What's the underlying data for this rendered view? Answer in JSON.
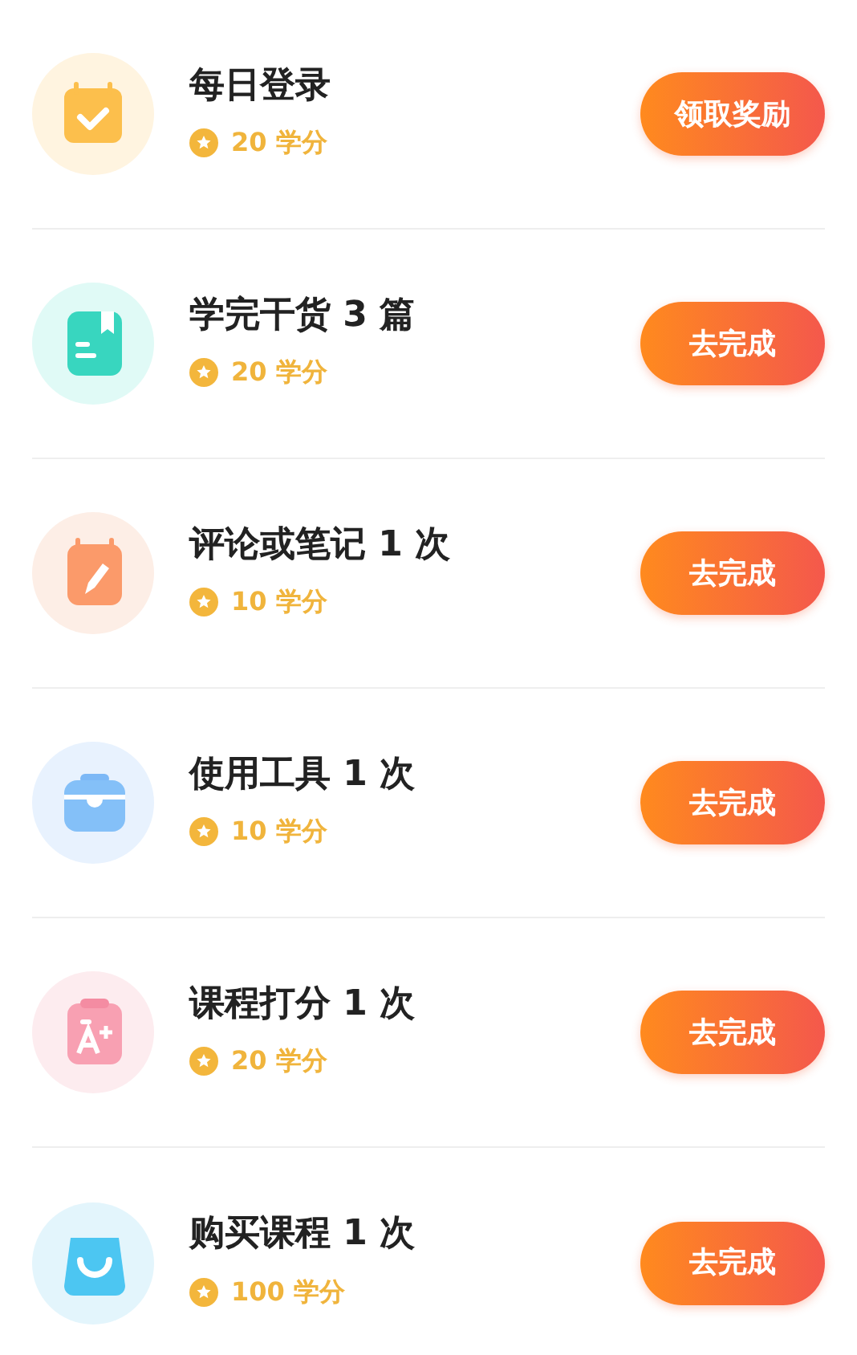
{
  "tasks": [
    {
      "kind": "calendar-check",
      "title": "每日登录",
      "points": "20 学分",
      "action": "领取奖励"
    },
    {
      "kind": "book",
      "title": "学完干货 3 篇",
      "points": "20 学分",
      "action": "去完成"
    },
    {
      "kind": "calendar-pencil",
      "title": "评论或笔记 1 次",
      "points": "10 学分",
      "action": "去完成"
    },
    {
      "kind": "toolbox",
      "title": "使用工具 1 次",
      "points": "10 学分",
      "action": "去完成"
    },
    {
      "kind": "clipboard",
      "title": "课程打分 1 次",
      "points": "20 学分",
      "action": "去完成"
    },
    {
      "kind": "bag",
      "title": "购买课程 1 次",
      "points": "100 学分",
      "action": "去完成"
    }
  ]
}
